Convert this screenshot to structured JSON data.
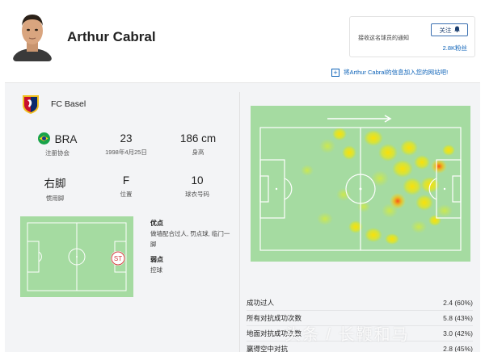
{
  "player": {
    "name": "Arthur Cabral"
  },
  "follow": {
    "notify_text": "接收这名球员的通知",
    "button_label": "关注",
    "button_icon": "bell-icon",
    "count": "2.8K粉丝"
  },
  "add_link": {
    "icon": "plus-box-icon",
    "text": "将Arthur Cabral的信息加入您的网站吧!"
  },
  "club": {
    "name": "FC Basel",
    "colors": [
      "#c8102e",
      "#0a2a6b",
      "#f0c020"
    ]
  },
  "profile": {
    "nationality": {
      "value": "BRA",
      "label": "注册协会"
    },
    "age": {
      "value": "23",
      "label": "1998年4月25日"
    },
    "height": {
      "value": "186 cm",
      "label": "身高"
    },
    "foot": {
      "value": "右脚",
      "label": "惯用脚"
    },
    "position": {
      "value": "F",
      "label": "位置"
    },
    "shirt": {
      "value": "10",
      "label": "球衣号码"
    }
  },
  "position_map": {
    "badge": "ST"
  },
  "strengths": {
    "title": "优点",
    "text": "做墙配合过人, 罚点球, 临门一脚",
    "weak_title": "弱点",
    "weak_text": "控球"
  },
  "stats": [
    {
      "label": "成功过人",
      "value": "2.4 (60%)"
    },
    {
      "label": "所有对抗成功次数",
      "value": "5.8 (43%)"
    },
    {
      "label": "地面对抗成功次数",
      "value": "3.0 (42%)"
    },
    {
      "label": "赢得空中对抗",
      "value": "2.8 (45%)"
    }
  ],
  "watermark": "头条 / 长鞭和马"
}
